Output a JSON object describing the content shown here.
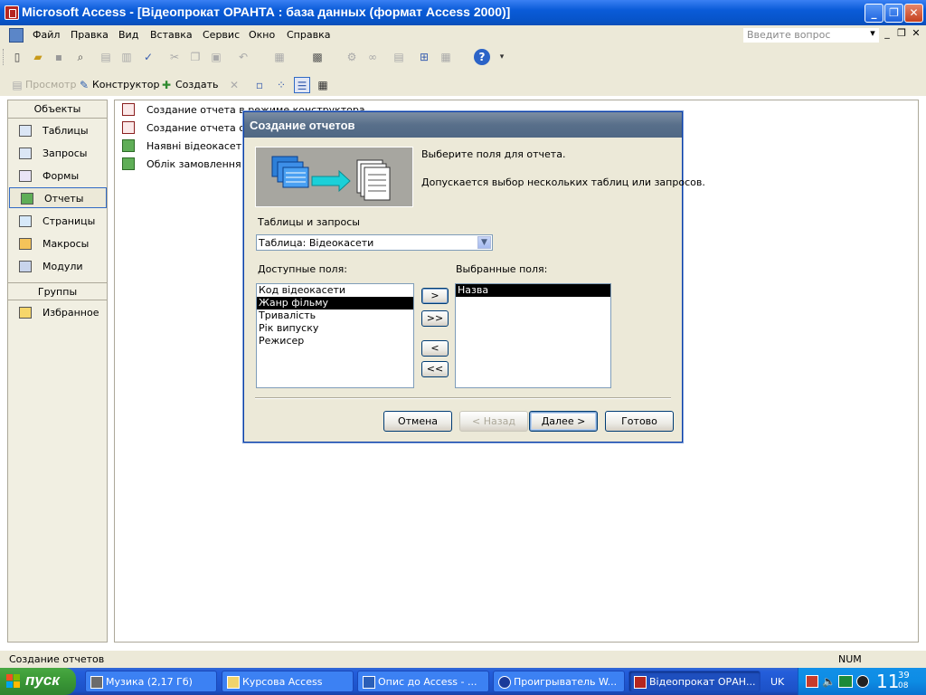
{
  "window": {
    "title": "Microsoft Access - [Відеопрокат ОРАНТА : база данных (формат Access 2000)]"
  },
  "menu": {
    "items": [
      "Файл",
      "Правка",
      "Вид",
      "Вставка",
      "Сервис",
      "Окно",
      "Справка"
    ],
    "ask_placeholder": "Введите вопрос"
  },
  "db_toolbar": {
    "preview": "Просмотр",
    "design": "Конструктор",
    "create": "Создать"
  },
  "objects": {
    "header": "Объекты",
    "items": [
      "Таблицы",
      "Запросы",
      "Формы",
      "Отчеты",
      "Страницы",
      "Макросы",
      "Модули"
    ],
    "groups_header": "Группы",
    "groups": [
      "Избранное"
    ]
  },
  "report_list": [
    "Создание отчета в режиме конструктора",
    "Создание отчета с помощью мастера",
    "Наявні відеокасети",
    "Облік замовлення відеокасет"
  ],
  "dialog": {
    "title": "Создание отчетов",
    "instruction": "Выберите поля для отчета.",
    "hint": "Допускается выбор нескольких таблиц или запросов.",
    "tables_label": "Таблицы и запросы",
    "tables_value": "Таблица: Відеокасети",
    "available_label": "Доступные поля:",
    "available_fields": [
      "Код відеокасети",
      "Жанр фільму",
      "Тривалість",
      "Рік випуску",
      "Режисер"
    ],
    "selected_label": "Выбранные поля:",
    "selected_fields": [
      "Назва"
    ],
    "btn_add": ">",
    "btn_add_all": ">>",
    "btn_remove": "<",
    "btn_remove_all": "<<",
    "btn_cancel": "Отмена",
    "btn_back": "< Назад",
    "btn_next": "Далее >",
    "btn_finish": "Готово"
  },
  "status": {
    "text": "Создание отчетов",
    "num": "NUM"
  },
  "taskbar": {
    "start": "пуск",
    "tasks": [
      "Музика (2,17 Гб)",
      "Курсова Access",
      "Опис до Access - ...",
      "Проигрыватель W...",
      "Відеопрокат ОРАН..."
    ],
    "lang": "UK",
    "clock_big": "11",
    "clock_top": "39",
    "clock_bottom": "08"
  }
}
